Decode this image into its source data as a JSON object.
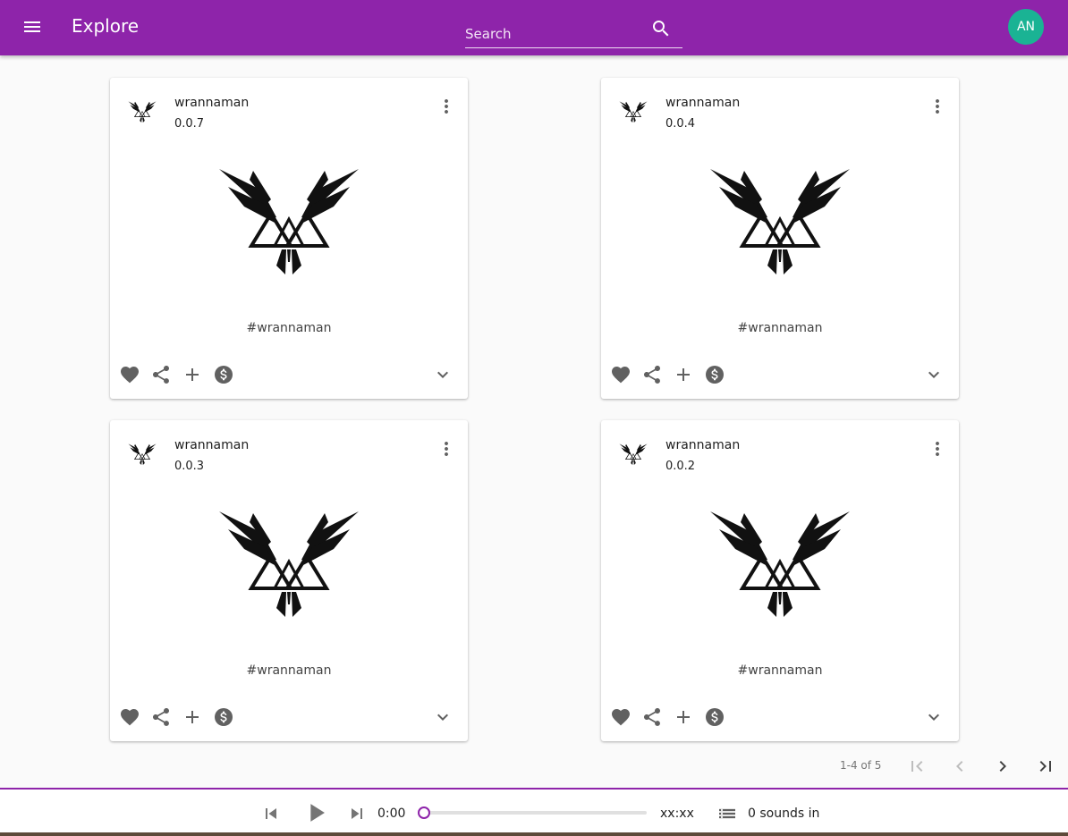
{
  "header": {
    "title": "Explore",
    "search": {
      "placeholder": "Search",
      "value": ""
    },
    "avatar_initials": "AN",
    "brand_color": "#8e24aa",
    "avatar_color": "#1ab394"
  },
  "cards": [
    {
      "author": "wrannaman",
      "version": "0.0.7",
      "tag": "#wrannaman"
    },
    {
      "author": "wrannaman",
      "version": "0.0.4",
      "tag": "#wrannaman"
    },
    {
      "author": "wrannaman",
      "version": "0.0.3",
      "tag": "#wrannaman"
    },
    {
      "author": "wrannaman",
      "version": "0.0.2",
      "tag": "#wrannaman"
    }
  ],
  "card_icons": [
    "more-vert-icon",
    "favorite-icon",
    "share-icon",
    "add-icon",
    "monetization-icon",
    "expand-more-icon"
  ],
  "pagination": {
    "range": "1-4 of 5"
  },
  "player": {
    "current_time": "0:00",
    "total_time": "xx:xx",
    "progress": 0,
    "queue_label": "0 sounds in"
  }
}
